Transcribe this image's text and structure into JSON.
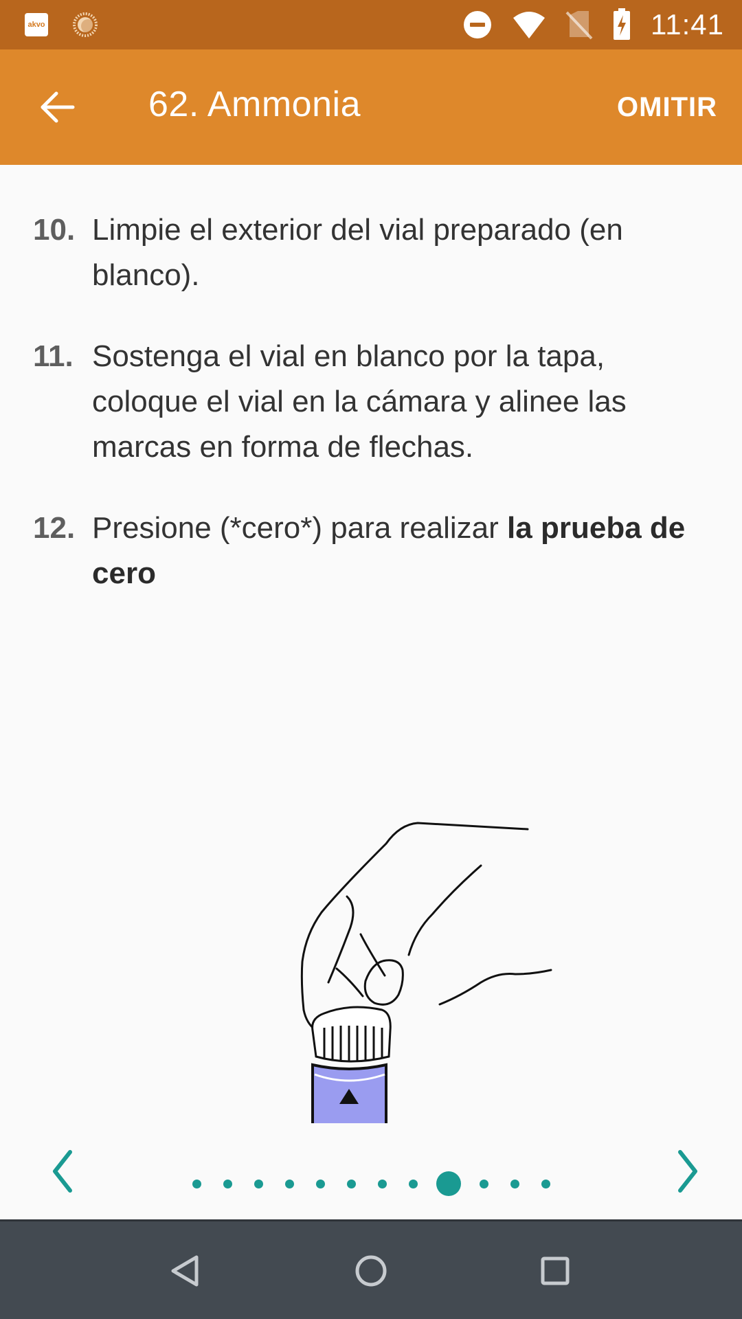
{
  "status_bar": {
    "time": "11:41",
    "left_icons": [
      "akvo-app-icon",
      "sun-icon"
    ],
    "right_icons": [
      "do-not-disturb-icon",
      "wifi-icon",
      "no-sim-icon",
      "battery-charging-icon"
    ],
    "akvo_label": "akvo"
  },
  "app_bar": {
    "title": "62. Ammonia",
    "skip_label": "OMITIR",
    "back_icon": "arrow-back-icon"
  },
  "steps": [
    {
      "number": "10.",
      "text": "Limpie el exterior del vial preparado (en blanco)."
    },
    {
      "number": "11.",
      "text": "Sostenga el vial en blanco por la tapa, coloque el vial en la cámara y alinee las marcas en forma de flechas."
    },
    {
      "number": "12.",
      "text": "Presione (*cero*) para realizar ",
      "bold": "la prueba de cero"
    }
  ],
  "illustration": {
    "icon": "hand-holding-vial-illustration",
    "vial_color": "#9a9cf0"
  },
  "pager": {
    "prev_icon": "chevron-left-icon",
    "next_icon": "chevron-right-icon",
    "total_pages": 12,
    "current_page": 9,
    "accent_color": "#1a9a92"
  },
  "nav_bar": {
    "icons": [
      "nav-back-icon",
      "nav-home-icon",
      "nav-recents-icon"
    ]
  },
  "colors": {
    "status_bar": "#b8661d",
    "app_bar": "#de882b",
    "background": "#fafafa",
    "nav_bar": "#434a51"
  }
}
